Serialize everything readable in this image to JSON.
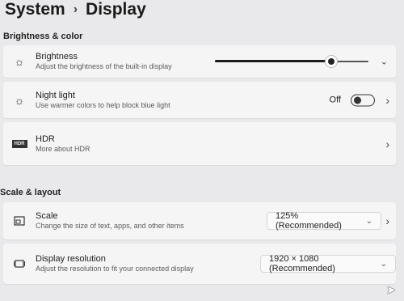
{
  "breadcrumb": {
    "parent": "System",
    "current": "Display"
  },
  "sections": {
    "brightness_color": "Brightness & color",
    "scale_layout": "Scale & layout"
  },
  "brightness": {
    "label": "Brightness",
    "description": "Adjust the brightness of the built-in display",
    "level": 0.76
  },
  "night_light": {
    "label": "Night light",
    "description": "Use warmer colors to help block blue light",
    "state": "Off"
  },
  "hdr": {
    "label": "HDR",
    "description": "More about HDR",
    "icon_text": "HDR"
  },
  "scale": {
    "label": "Scale",
    "description": "Change the size of text, apps, and other items",
    "value": "125% (Recommended)"
  },
  "resolution": {
    "label": "Display resolution",
    "description": "Adjust the resolution to fit your connected display",
    "value": "1920 × 1080 (Recommended)"
  },
  "icons": {
    "chevron_right": "›",
    "chevron_down": "⌄",
    "sun": "☼"
  }
}
